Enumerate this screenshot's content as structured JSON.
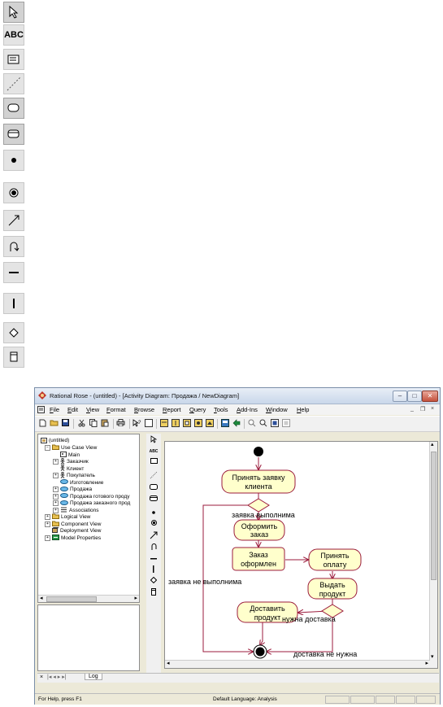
{
  "palette_large": {
    "tools": [
      "pointer-icon",
      "text-box-icon",
      "note-icon",
      "anchor-note-icon",
      "activity-icon",
      "state-icon",
      "start-state-icon",
      "end-state-icon",
      "state-transition-icon",
      "transition-to-self-icon",
      "horizontal-sync-icon",
      "vertical-sync-icon",
      "decision-icon",
      "swimlane-icon"
    ],
    "text_tool_label": "ABC"
  },
  "window": {
    "title": "Rational Rose - (untitled) - [Activity Diagram: Продажа / NewDiagram]",
    "menu": [
      "File",
      "Edit",
      "View",
      "Format",
      "Browse",
      "Report",
      "Query",
      "Tools",
      "Add-Ins",
      "Window",
      "Help"
    ],
    "mdi_controls": [
      "_",
      "❐",
      "×"
    ],
    "caption_buttons": [
      "‒",
      "□",
      "✕"
    ]
  },
  "browser": {
    "root": "(untitled)",
    "items": [
      {
        "label": "Use Case View",
        "expander": "−",
        "icon": "folder-icon"
      },
      {
        "label": "Main",
        "expander": "",
        "icon": "diagram-icon"
      },
      {
        "label": "Заказчик",
        "expander": "+",
        "icon": "actor-icon"
      },
      {
        "label": "Клиент",
        "expander": "",
        "icon": "actor-icon"
      },
      {
        "label": "Покупатель",
        "expander": "+",
        "icon": "actor-icon"
      },
      {
        "label": "Изготовление",
        "expander": "",
        "icon": "use-case-icon"
      },
      {
        "label": "Продажа",
        "expander": "+",
        "icon": "use-case-icon"
      },
      {
        "label": "Продажа готового проду",
        "expander": "+",
        "icon": "use-case-icon"
      },
      {
        "label": "Продажа заказного прод",
        "expander": "+",
        "icon": "use-case-icon"
      },
      {
        "label": "Associations",
        "expander": "+",
        "icon": "associations-icon"
      },
      {
        "label": "Logical View",
        "expander": "+",
        "icon": "folder-icon"
      },
      {
        "label": "Component View",
        "expander": "+",
        "icon": "folder-icon"
      },
      {
        "label": "Deployment View",
        "expander": "",
        "icon": "deployment-icon"
      },
      {
        "label": "Model Properties",
        "expander": "+",
        "icon": "properties-icon"
      }
    ]
  },
  "diagram": {
    "activities": {
      "accept_request": "Принять заявку клиента",
      "process_order": "Оформить заказ",
      "order_done": "Заказ оформлен",
      "accept_payment": "Принять оплату",
      "deliver_product": "Выдать продукт",
      "deliver_shipping": "Доставить продукт"
    },
    "guards": {
      "feasible": "заявка выполнима",
      "not_feasible": "заявка не выполнима",
      "need_delivery": "нужна доставка",
      "no_delivery": "доставка не нужна"
    },
    "colors": {
      "activity_fill": "#ffffcc",
      "line": "#9b1b3c",
      "text": "#000000"
    }
  },
  "log_tab": "Log",
  "status": {
    "help": "For Help, press F1",
    "language": "Default Language: Analysis"
  }
}
